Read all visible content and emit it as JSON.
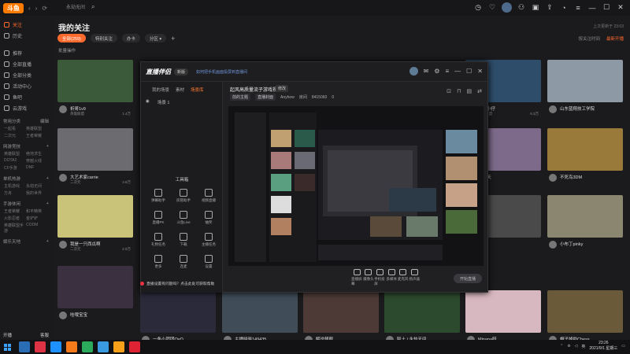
{
  "topbar": {
    "logo_text": "斗鱼",
    "search_placeholder": "永劫无间",
    "icons": [
      "clock-icon",
      "heart-icon",
      "avatar",
      "shirt-icon",
      "box-icon",
      "upload-icon",
      "bell-icon",
      "menu-icon",
      "minimize-icon",
      "maximize-icon",
      "close-icon"
    ]
  },
  "sidebar": {
    "items": [
      {
        "label": "关注",
        "active": true
      },
      {
        "label": "历史",
        "active": false
      },
      {
        "label": "推荐",
        "active": false
      },
      {
        "label": "全部直播",
        "active": false
      },
      {
        "label": "全部分类",
        "active": false
      },
      {
        "label": "活动中心",
        "active": false
      },
      {
        "label": "鱼吧",
        "active": false
      },
      {
        "label": "云游戏",
        "active": false
      }
    ],
    "groups": [
      {
        "title": "常用分类",
        "more": "编辑",
        "subs": [
          "一起看",
          "英雄联盟",
          "二次元",
          "王者荣耀"
        ]
      },
      {
        "title": "网游竞技",
        "more": "+",
        "subs": [
          "英雄联盟",
          "绝地求生",
          "DOTA2",
          "穿越火线",
          "CF手游",
          "DNF"
        ]
      },
      {
        "title": "单机热游",
        "more": "+",
        "subs": [
          "主机游戏",
          "永劫无间",
          "方舟",
          "我的世界"
        ]
      },
      {
        "title": "手游休闲",
        "more": "+",
        "subs": [
          "王者荣耀",
          "和平精英",
          "火影忍者",
          "金铲铲",
          "英雄联盟手游",
          "CODM"
        ]
      },
      {
        "title": "娱乐天地",
        "more": "+",
        "subs": []
      }
    ],
    "bottom": {
      "left": "开播",
      "right": "客服"
    }
  },
  "main": {
    "title": "我的关注",
    "update_time": "上次更新于 23:03",
    "filters": [
      {
        "label": "全部(259)",
        "active": true
      },
      {
        "label": "特别关注",
        "active": false
      },
      {
        "label": "办卡",
        "active": false
      },
      {
        "label": "分区 ▾",
        "active": false
      }
    ],
    "sort": [
      {
        "label": "按关注时间",
        "active": false
      },
      {
        "label": "最新开播",
        "active": true
      }
    ],
    "batch_label": "批量操作"
  },
  "cards": [
    {
      "name": "祈哥1v9",
      "sub": "英雄联盟",
      "heat": "1.4万",
      "color": "#3b5a3a"
    },
    {
      "name": "大艺术家carrie",
      "sub": "二次元",
      "heat": "3.8万",
      "color": "#6b6b70"
    },
    {
      "name": "我是一只西瓜啊",
      "sub": "二次元",
      "heat": "2.9万",
      "color": "#c9c37a"
    },
    {
      "name": "哇哦宝宝",
      "sub": "",
      "heat": "",
      "color": "#3a3040"
    },
    {
      "name": "一条小团团OvO",
      "sub": "",
      "heat": "",
      "color": "#2a2a3a"
    },
    {
      "name": "主播晓晓149435",
      "sub": "",
      "heat": "",
      "color": "#404c58"
    },
    {
      "name": "解说靓靓",
      "sub": "",
      "heat": "",
      "color": "#4d3a36"
    },
    {
      "name": "阿土 | 永劫无间",
      "sub": "",
      "heat": "",
      "color": "#2c4a2e"
    },
    {
      "name": "Minana呀",
      "sub": "",
      "heat": "",
      "color": "#d8b8c0"
    },
    {
      "name": "帽子掉啦Chess",
      "sub": "",
      "heat": "",
      "color": "#6b5a3a"
    },
    {
      "name": "一只小仔",
      "sub": "英雄联盟",
      "heat": "8.3万",
      "color": "#2d4d6a"
    },
    {
      "name": "山东蓝翔技工学院",
      "sub": "",
      "heat": "",
      "color": "#8d9aa5"
    },
    {
      "name": "zh大天",
      "sub": "",
      "heat": "",
      "color": "#7d6a8a"
    },
    {
      "name": "不死鸟3DM",
      "sub": "",
      "heat": "",
      "color": "#9a7a3a"
    },
    {
      "name": "小布丁pinky",
      "sub": "",
      "heat": "",
      "color": "#8b8670"
    },
    {
      "name": "",
      "sub": "",
      "heat": "",
      "color": "#4a4a4a"
    }
  ],
  "popup": {
    "app_name": "直播伴侣",
    "version": "新版",
    "link_text": "如何把手机画面投屏到直播间",
    "left_tabs": [
      {
        "label": "我的场景",
        "active": false
      },
      {
        "label": "素材",
        "active": false
      },
      {
        "label": "场景库",
        "active": true
      }
    ],
    "scene_label": "场景 1",
    "tools_title": "工具箱",
    "tools": [
      "弹幕助手",
      "房管助手",
      "视频直播",
      "直播PK",
      "斗鱼Live",
      "抽奖",
      "礼物任务",
      "下载",
      "主播任务",
      "更多",
      "连麦",
      "设置"
    ],
    "room_title": "起风高质量流子游戏视频",
    "room_edit": "修改",
    "room_meta": [
      "前的主题",
      "直播封面",
      "Anyhow",
      "房间",
      "8415060",
      "0"
    ],
    "controls": [
      "直播屏幕",
      "摄像头",
      "手机投屏",
      "多媒体",
      "麦克风",
      "扬声器"
    ],
    "start_live": "开始直播",
    "notice": "直播设置有问题吗？点击此处可获取帮助"
  },
  "taskbar": {
    "time": "23:26",
    "date": "2021/9/1 星期三",
    "lang": "英"
  }
}
